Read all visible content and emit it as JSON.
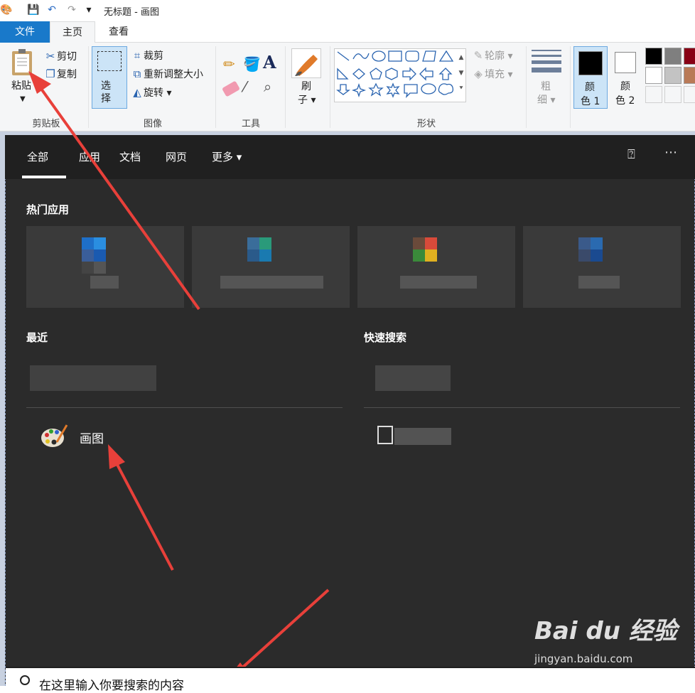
{
  "titlebar": {
    "title": "无标题 - 画图",
    "qa_dropdown": "▾"
  },
  "tabs": {
    "file": "文件",
    "home": "主页",
    "view": "查看"
  },
  "ribbon": {
    "clipboard": {
      "paste": "粘贴",
      "cut": "剪切",
      "copy": "复制",
      "label": "剪贴板"
    },
    "image": {
      "select": "选\n择",
      "crop": "裁剪",
      "resize": "重新调整大小",
      "rotate": "旋转",
      "label": "图像"
    },
    "tools": {
      "label": "工具",
      "text_tool": "A"
    },
    "brush": {
      "label_top": "刷",
      "label_bottom": "子"
    },
    "shapes": {
      "label": "形状",
      "outline": "轮廓",
      "fill": "填充"
    },
    "size": {
      "top": "粗",
      "bottom": "细"
    },
    "color1": {
      "top": "颜",
      "bottom": "色 1"
    },
    "color2": {
      "top": "颜",
      "bottom": "色 2"
    },
    "palette": [
      "#000000",
      "#7f7f7f",
      "#880015",
      "#ffffff",
      "#c3c3c3",
      "#b97a57"
    ]
  },
  "search": {
    "tabs": [
      "全部",
      "应用",
      "文档",
      "网页",
      "更多 ▾"
    ],
    "hot_apps_title": "热门应用",
    "recent_title": "最近",
    "quick_search_title": "快速搜索",
    "result_paint": "画图",
    "placeholder": "在这里输入你要搜索的内容"
  },
  "watermark": {
    "logo": "Bai du 经验",
    "url": "jingyan.baidu.com"
  }
}
